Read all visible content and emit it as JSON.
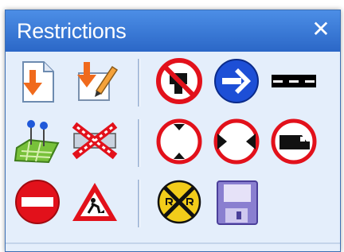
{
  "window": {
    "title": "Restrictions",
    "close_glyph": "✕"
  },
  "toolbar": {
    "buttons": [
      {
        "name": "import-icon",
        "tooltip": ""
      },
      {
        "name": "edit-import-icon",
        "tooltip": ""
      },
      {
        "name": "no-entry-vehicle-icon",
        "tooltip": ""
      },
      {
        "name": "one-way-arrow-icon",
        "tooltip": ""
      },
      {
        "name": "road-segment-icon",
        "tooltip": ""
      },
      {
        "name": "map-points-icon",
        "tooltip": ""
      },
      {
        "name": "closed-road-icon",
        "tooltip": ""
      },
      {
        "name": "height-limit-icon",
        "tooltip": ""
      },
      {
        "name": "width-limit-icon",
        "tooltip": ""
      },
      {
        "name": "truck-restriction-icon",
        "tooltip": ""
      },
      {
        "name": "do-not-enter-icon",
        "tooltip": ""
      },
      {
        "name": "roadworks-icon",
        "tooltip": ""
      },
      {
        "name": "railroad-crossing-icon",
        "tooltip": ""
      },
      {
        "name": "save-icon",
        "tooltip": ""
      }
    ]
  }
}
